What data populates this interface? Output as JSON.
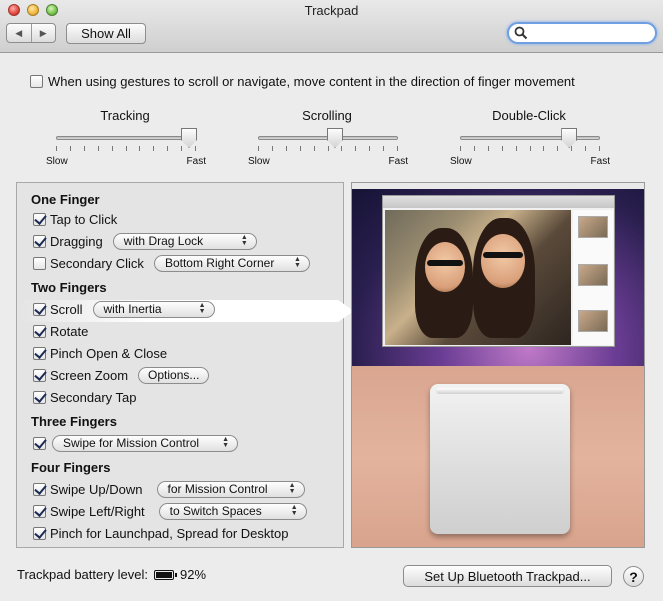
{
  "window": {
    "title": "Trackpad",
    "show_all_label": "Show All",
    "nav_back_icon": "back-icon",
    "nav_forward_icon": "forward-icon",
    "search_placeholder": "",
    "search_value": ""
  },
  "gesture_option": {
    "label": "When using gestures to scroll or navigate, move content in the direction of finger movement",
    "checked": false
  },
  "sliders": [
    {
      "label": "Tracking",
      "min_label": "Slow",
      "max_label": "Fast",
      "level": 0.95
    },
    {
      "label": "Scrolling",
      "min_label": "Slow",
      "max_label": "Fast",
      "level": 0.55
    },
    {
      "label": "Double-Click",
      "min_label": "Slow",
      "max_label": "Fast",
      "level": 0.78
    }
  ],
  "sections": {
    "one_finger": {
      "title": "One Finger",
      "tap_to_click": {
        "label": "Tap to Click",
        "checked": true
      },
      "dragging": {
        "label": "Dragging",
        "checked": true,
        "option": "with Drag Lock"
      },
      "secondary_click": {
        "label": "Secondary Click",
        "checked": false,
        "option": "Bottom Right Corner"
      }
    },
    "two_fingers": {
      "title": "Two Fingers",
      "scroll": {
        "label": "Scroll",
        "checked": true,
        "option": "with Inertia"
      },
      "rotate": {
        "label": "Rotate",
        "checked": true
      },
      "pinch": {
        "label": "Pinch Open & Close",
        "checked": true
      },
      "screen_zoom": {
        "label": "Screen Zoom",
        "checked": true,
        "button": "Options..."
      },
      "secondary_tap": {
        "label": "Secondary Tap",
        "checked": true
      }
    },
    "three_fingers": {
      "title": "Three Fingers",
      "swipe": {
        "checked": true,
        "option": "Swipe for Mission Control"
      }
    },
    "four_fingers": {
      "title": "Four Fingers",
      "swipe_up_down": {
        "label": "Swipe Up/Down",
        "checked": true,
        "option": "for Mission Control"
      },
      "swipe_left_right": {
        "label": "Swipe Left/Right",
        "checked": true,
        "option": "to Switch Spaces"
      },
      "pinch_launchpad": {
        "label": "Pinch for Launchpad, Spread for Desktop",
        "checked": true
      }
    }
  },
  "footer": {
    "battery_label": "Trackpad battery level:",
    "battery_value": "92%",
    "bluetooth_button": "Set Up Bluetooth Trackpad...",
    "help_label": "?"
  }
}
